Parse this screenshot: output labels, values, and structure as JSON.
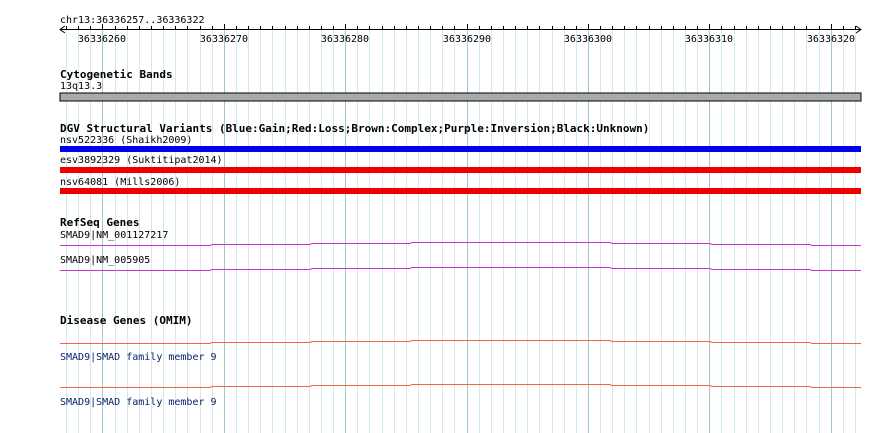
{
  "ruler": {
    "region": "chr13:36336257..36336322",
    "start": 36336257,
    "end": 36336322,
    "ticks": [
      "36336260",
      "36336270",
      "36336280",
      "36336290",
      "36336300",
      "36336310",
      "36336320"
    ]
  },
  "tracks": {
    "cytoband": {
      "title": "Cytogenetic Bands",
      "band": "13q13.3",
      "color": "#aaaaaa"
    },
    "dgv": {
      "title": "DGV Structural Variants (Blue:Gain;Red:Loss;Brown:Complex;Purple:Inversion;Black:Unknown)",
      "variants": [
        {
          "label": "nsv522336 (Shaikh2009)",
          "type": "Gain",
          "color": "#0000ee"
        },
        {
          "label": "esv3892329 (Suktitipat2014)",
          "type": "Loss",
          "color": "#ee0000"
        },
        {
          "label": "nsv64081 (Mills2006)",
          "type": "Loss",
          "color": "#ee0000"
        }
      ]
    },
    "refseq": {
      "title": "RefSeq Genes",
      "genes": [
        {
          "label": "SMAD9|NM_001127217"
        },
        {
          "label": "SMAD9|NM_005905"
        }
      ],
      "color": "#cc33cc"
    },
    "omim": {
      "title": "Disease Genes (OMIM)",
      "genes": [
        {
          "label": "SMAD9|SMAD family member 9"
        },
        {
          "label": "SMAD9|SMAD family member 9"
        }
      ],
      "color": "#ee6644"
    }
  },
  "colors": {
    "grid_major": "#9fc7d6",
    "grid_minor": "#d4e8ef",
    "label_blue": "#0a246a"
  }
}
